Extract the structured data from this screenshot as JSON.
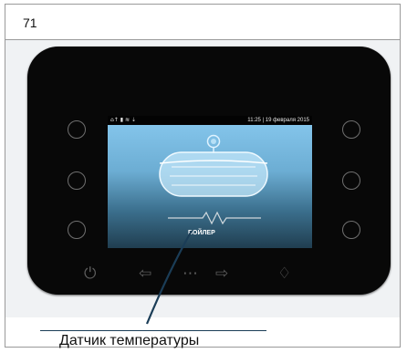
{
  "figure_number": "71",
  "display": {
    "status_icons": "⌂↑ ▮ ≋ ⇣",
    "clock": "11:25 | 19 февраля 2015",
    "boiler_label": "БОЙЛЕР"
  },
  "soft_keys": [
    {
      "icon": "power-icon",
      "glyph": "⏻"
    },
    {
      "icon": "arrow-left-icon",
      "glyph": "⇦"
    },
    {
      "icon": "menu-dots-icon",
      "glyph": "⋯"
    },
    {
      "icon": "arrow-right-icon",
      "glyph": "⇨"
    },
    {
      "icon": "water-drop-icon",
      "glyph": "♢"
    }
  ],
  "callout": "Датчик температуры",
  "colors": {
    "panel": "#080808",
    "screen_top": "#88c9ef",
    "screen_bottom": "#203e50",
    "leader_line": "#1b3d57"
  }
}
